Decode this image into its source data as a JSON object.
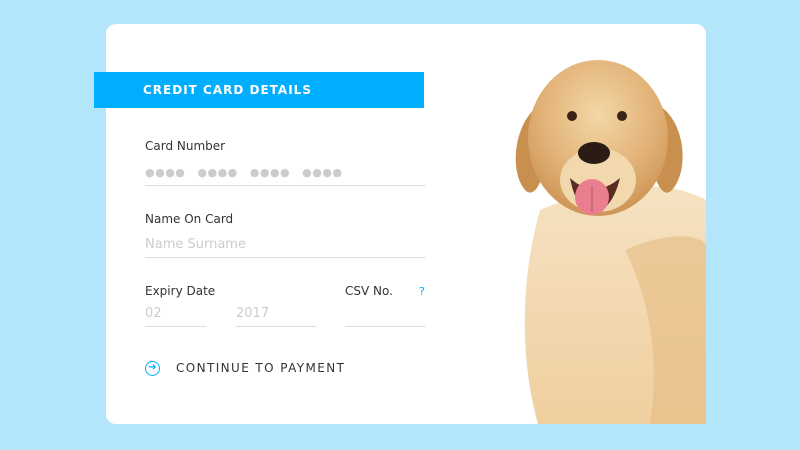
{
  "header": {
    "title": "CREDIT CARD DETAILS"
  },
  "card_number": {
    "label": "Card Number",
    "placeholder": "●●●●   ●●●●   ●●●●   ●●●●"
  },
  "name_on_card": {
    "label": "Name On Card",
    "placeholder": "Name Surname"
  },
  "expiry": {
    "label": "Expiry Date",
    "month_placeholder": "02",
    "year_placeholder": "2017"
  },
  "csv": {
    "label": "CSV No.",
    "help": "?"
  },
  "continue": {
    "label": "CONTINUE TO PAYMENT"
  },
  "colors": {
    "accent": "#00aeff",
    "background": "#b3e5fb",
    "card": "#ffffff"
  },
  "icons": {
    "continue": "arrow-circle-right-icon"
  }
}
